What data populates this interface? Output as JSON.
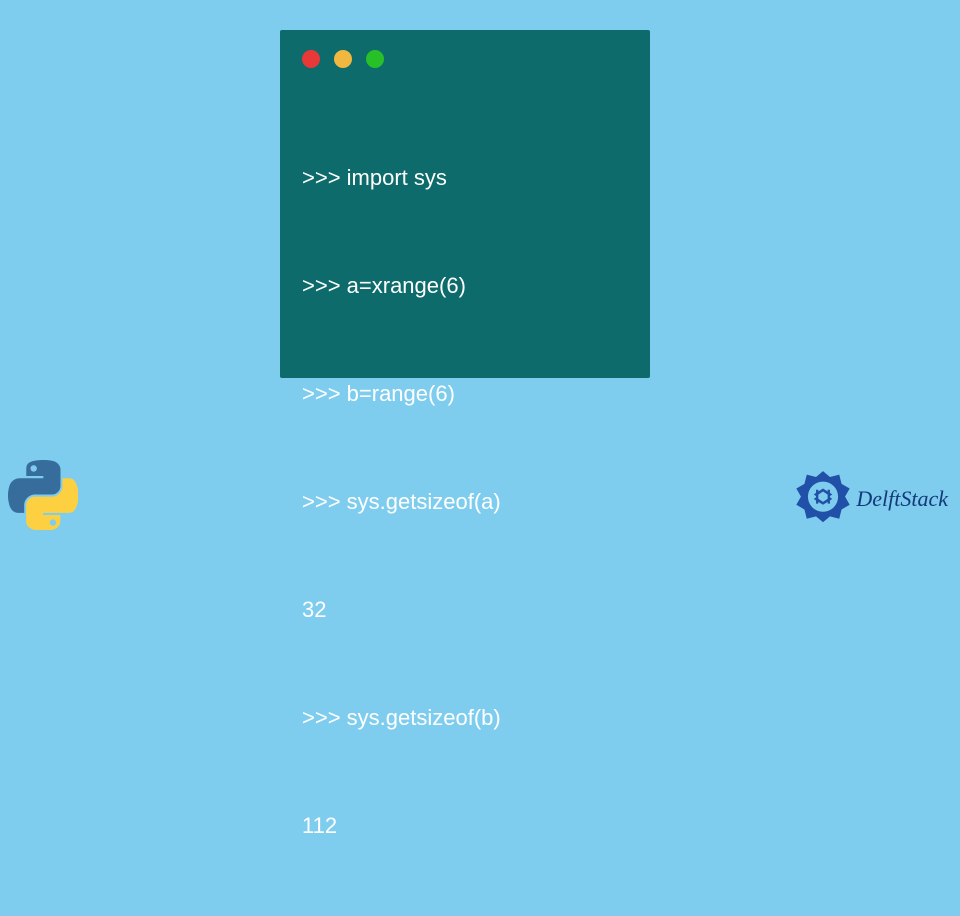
{
  "terminal": {
    "lines": [
      ">>> import sys",
      ">>> a=xrange(6)",
      ">>> b=range(6)",
      ">>> sys.getsizeof(a)",
      "32",
      ">>> sys.getsizeof(b)",
      "112"
    ]
  },
  "branding": {
    "site_name": "DelftStack"
  },
  "colors": {
    "background": "#7fcdee",
    "terminal_bg": "#0d6b6b",
    "terminal_text": "#ffffff",
    "dot_red": "#e83838",
    "dot_yellow": "#f0b840",
    "dot_green": "#28c028",
    "brand_blue": "#133a7a"
  }
}
